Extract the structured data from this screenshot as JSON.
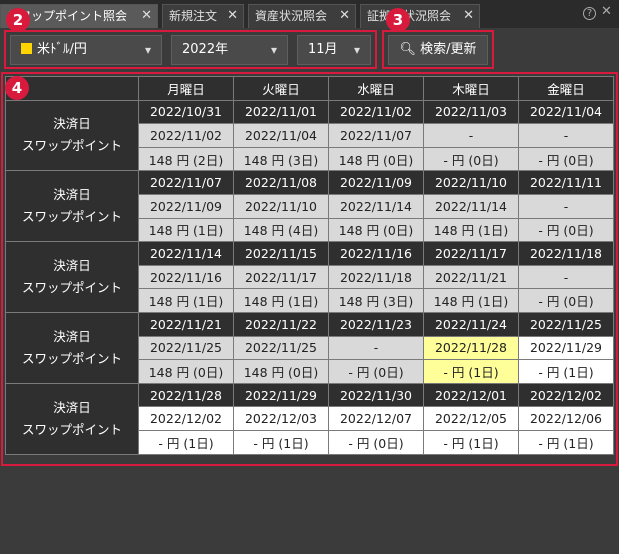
{
  "tabs": [
    {
      "label": "スワップポイント照会",
      "close": "✕"
    },
    {
      "label": "新規注文",
      "close": "✕"
    },
    {
      "label": "資産状況照会",
      "close": "✕"
    },
    {
      "label": "証拠金状況照会",
      "close": "✕"
    }
  ],
  "window_icons": {
    "help": "?",
    "close": "✕"
  },
  "filters": {
    "currency_pair": "米ﾄﾞﾙ/円",
    "currency_color": "#ffd400",
    "year": "2022年",
    "month": "11月",
    "search_label": "検索/更新",
    "chevron": "⌄"
  },
  "badges": [
    "2",
    "3",
    "4"
  ],
  "table": {
    "weekdays": [
      "月曜日",
      "火曜日",
      "水曜日",
      "木曜日",
      "金曜日"
    ],
    "row_label_1": "決済日",
    "row_label_2": "スワップポイント",
    "weeks": [
      {
        "dates": [
          "2022/10/31",
          "2022/11/01",
          "2022/11/02",
          "2022/11/03",
          "2022/11/04"
        ],
        "settle": [
          "2022/11/02",
          "2022/11/04",
          "2022/11/07",
          "-",
          "-"
        ],
        "points": [
          "148 円 (2日)",
          "148 円 (3日)",
          "148 円 (0日)",
          "- 円 (0日)",
          "- 円 (0日)"
        ]
      },
      {
        "dates": [
          "2022/11/07",
          "2022/11/08",
          "2022/11/09",
          "2022/11/10",
          "2022/11/11"
        ],
        "settle": [
          "2022/11/09",
          "2022/11/10",
          "2022/11/14",
          "2022/11/14",
          "-"
        ],
        "points": [
          "148 円 (1日)",
          "148 円 (4日)",
          "148 円 (0日)",
          "148 円 (1日)",
          "- 円 (0日)"
        ]
      },
      {
        "dates": [
          "2022/11/14",
          "2022/11/15",
          "2022/11/16",
          "2022/11/17",
          "2022/11/18"
        ],
        "settle": [
          "2022/11/16",
          "2022/11/17",
          "2022/11/18",
          "2022/11/21",
          "-"
        ],
        "points": [
          "148 円 (1日)",
          "148 円 (1日)",
          "148 円 (3日)",
          "148 円 (1日)",
          "- 円 (0日)"
        ]
      },
      {
        "dates": [
          "2022/11/21",
          "2022/11/22",
          "2022/11/23",
          "2022/11/24",
          "2022/11/25"
        ],
        "settle": [
          "2022/11/25",
          "2022/11/25",
          "-",
          "2022/11/28",
          "2022/11/29"
        ],
        "points": [
          "148 円 (0日)",
          "148 円 (0日)",
          "- 円 (0日)",
          "- 円 (1日)",
          "- 円 (1日)"
        ]
      },
      {
        "dates": [
          "2022/11/28",
          "2022/11/29",
          "2022/11/30",
          "2022/12/01",
          "2022/12/02"
        ],
        "settle": [
          "2022/12/02",
          "2022/12/03",
          "2022/12/07",
          "2022/12/05",
          "2022/12/06"
        ],
        "points": [
          "- 円 (1日)",
          "- 円 (1日)",
          "- 円 (0日)",
          "- 円 (1日)",
          "- 円 (1日)"
        ]
      }
    ]
  }
}
